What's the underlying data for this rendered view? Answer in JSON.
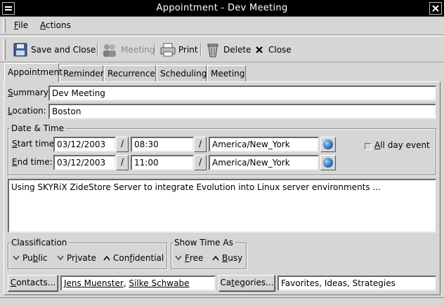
{
  "window": {
    "title": "Appointment - Dev Meeting"
  },
  "menu": {
    "file_mnemonic": "F",
    "file_rest": "ile",
    "actions_mnemonic": "A",
    "actions_rest": "ctions"
  },
  "toolbar": {
    "save_close": "Save and Close",
    "meeting": "Meeting",
    "print": "Print",
    "delete": "Delete",
    "close": "Close"
  },
  "tabs": [
    "Appointment",
    "Reminder",
    "Recurrence",
    "Scheduling",
    "Meeting"
  ],
  "form": {
    "summary_mnemonic": "S",
    "summary_rest": "ummary:",
    "summary_value": "Dev Meeting",
    "location_mnemonic": "L",
    "location_rest": "ocation:",
    "location_value": "Boston",
    "datetime_title": "Date & Time",
    "start_mnemonic": "S",
    "start_rest": "tart time:",
    "start_date": "03/12/2003",
    "start_time": "08:30",
    "start_tz": "America/New_York",
    "end_mnemonic": "E",
    "end_rest": "nd time:",
    "end_date": "03/12/2003",
    "end_time": "11:00",
    "end_tz": "America/New_York",
    "date_btn": "/",
    "allday_mnemonic": "A",
    "allday_rest": "ll day event",
    "description": "Using SKYRiX ZideStore Server to integrate Evolution into Linux server environments ...",
    "classification_title": "Classification",
    "class_public_a": "Pu",
    "class_public_m": "b",
    "class_public_b": "lic",
    "class_private_a": "Pr",
    "class_private_m": "i",
    "class_private_b": "vate",
    "class_conf_a": "Con",
    "class_conf_m": "f",
    "class_conf_b": "idential",
    "showtime_title": "Show Time As",
    "free_a": "",
    "free_m": "F",
    "free_b": "ree",
    "busy_a": "",
    "busy_m": "B",
    "busy_b": "usy",
    "contacts_m": "C",
    "contacts_rest": "ontacts...",
    "contacts_1": "Jens Muenster",
    "contacts_sep": ", ",
    "contacts_2": "Silke Schwabe",
    "categories_m": "t",
    "categories_a": "Ca",
    "categories_b": "egories...",
    "categories_value": "Favorites, Ideas, Strategies"
  }
}
